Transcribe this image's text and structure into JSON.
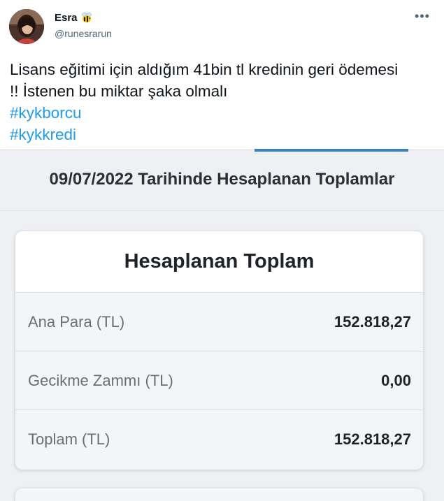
{
  "tweet": {
    "author_name": "Esra",
    "author_emoji": "bee-icon",
    "author_handle": "@runesrarun",
    "text_line1": "Lisans eğitimi için aldığım 41bin tl kredinin geri ödemesi",
    "text_line2": "!! İstenen bu miktar şaka olmalı",
    "hashtags": [
      "#kykborcu",
      "#kykkredi"
    ],
    "more_icon": "more-icon",
    "colors": {
      "hashtag": "#1d9bf0",
      "handle": "#536471"
    }
  },
  "screenshot": {
    "heading": "09/07/2022 Tarihinde Hesaplanan Toplamlar",
    "card": {
      "title": "Hesaplanan Toplam",
      "rows": [
        {
          "label": "Ana Para (TL)",
          "value": "152.818,27"
        },
        {
          "label": "Gecikme Zammı (TL)",
          "value": "0,00"
        },
        {
          "label": "Toplam (TL)",
          "value": "152.818,27"
        }
      ]
    },
    "colors": {
      "tab_indicator": "#3b82c4",
      "background": "#eef0f3"
    }
  }
}
